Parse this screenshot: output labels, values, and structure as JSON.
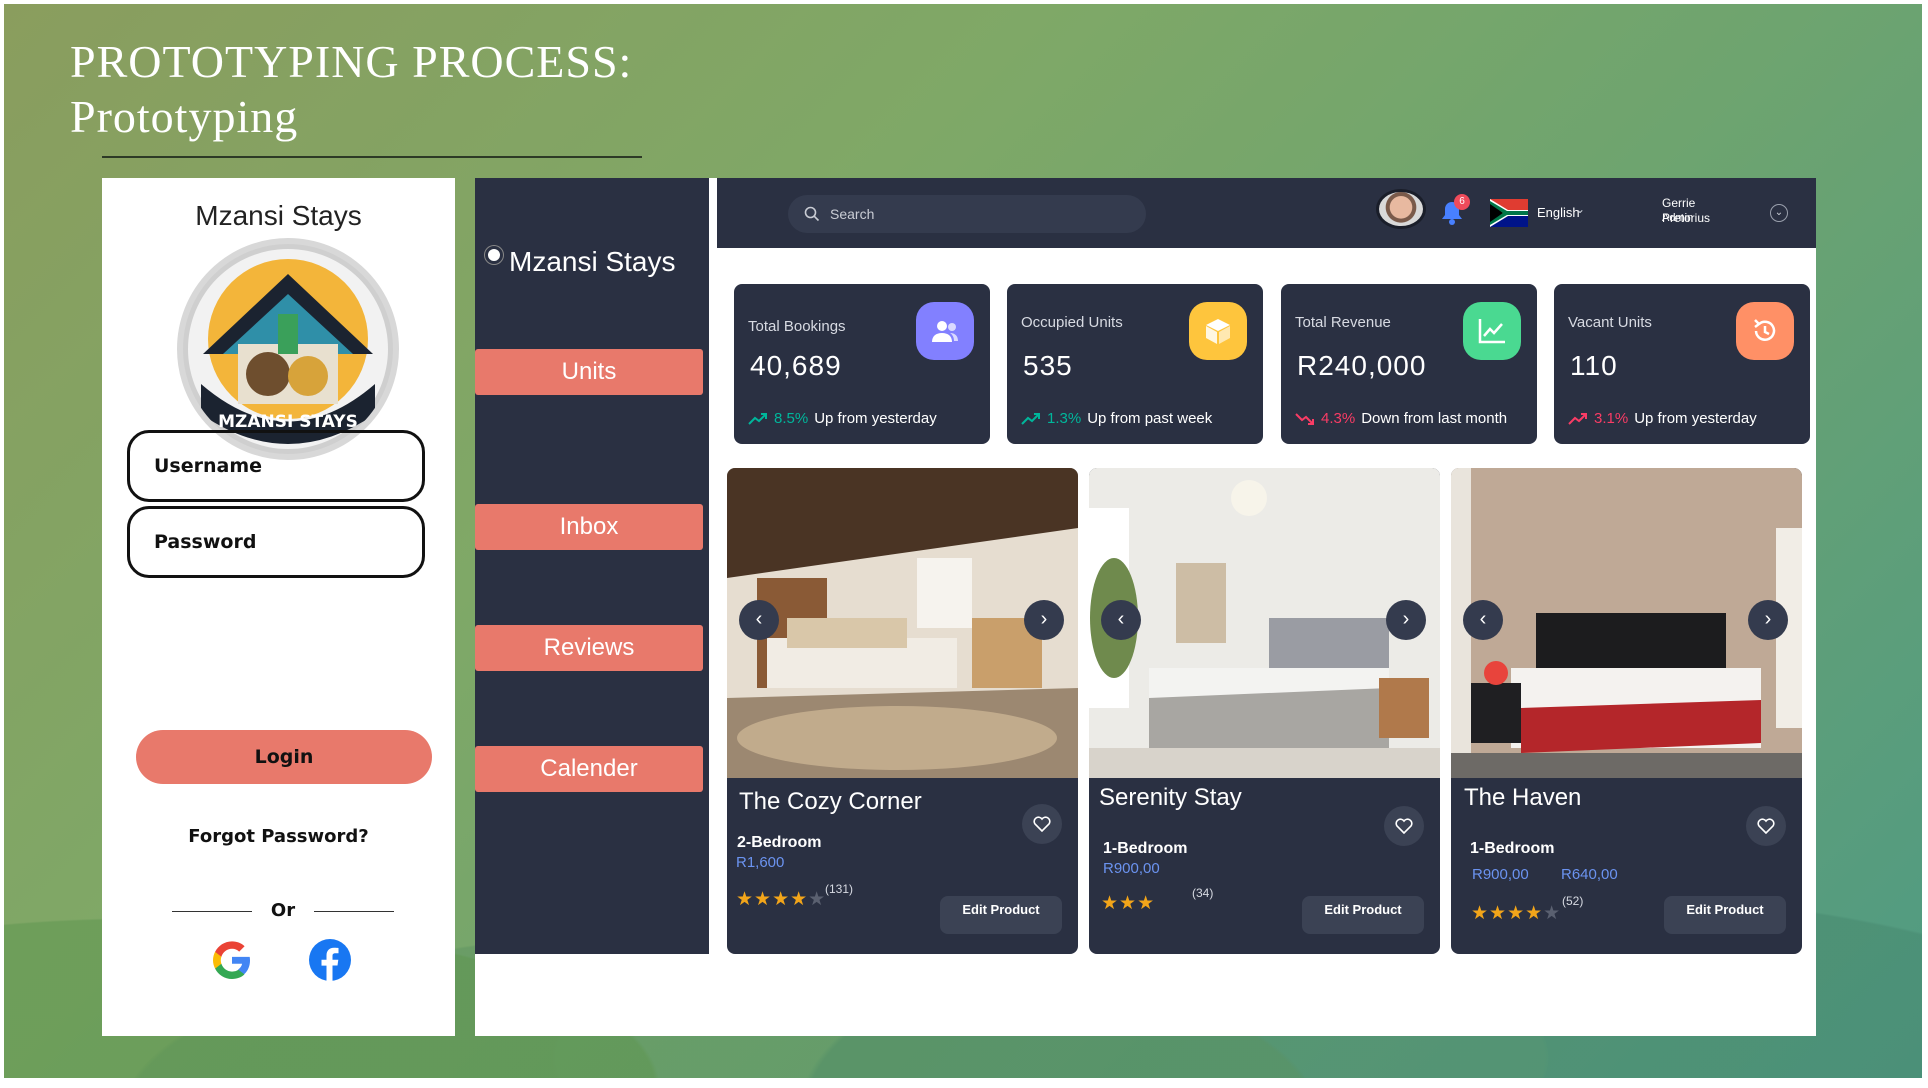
{
  "slide": {
    "title_line1": "PROTOTYPING PROCESS:",
    "title_line2": "Prototyping"
  },
  "login": {
    "brand": "Mzansi Stays",
    "logo_text": "MZANSI STAYS",
    "username_placeholder": "Username",
    "password_placeholder": "Password",
    "login_label": "Login",
    "forgot_label": "Forgot Password?",
    "or_label": "Or",
    "social": [
      "google-icon",
      "facebook-icon"
    ]
  },
  "sidebar": {
    "brand": "Mzansi Stays",
    "items": [
      {
        "label": "Units"
      },
      {
        "label": "Inbox"
      },
      {
        "label": "Reviews"
      },
      {
        "label": "Calender"
      }
    ]
  },
  "topbar": {
    "search_placeholder": "Search",
    "notification_count": "6",
    "language": "English",
    "user_name": "Gerrie Pretorius",
    "user_role": "Admin"
  },
  "stats": [
    {
      "label": "Total Bookings",
      "value": "40,689",
      "pct": "8.5%",
      "trend_text": "Up from yesterday",
      "direction": "up",
      "icon": "users-icon",
      "icon_bg": "#8280ff"
    },
    {
      "label": "Occupied Units",
      "value": "535",
      "pct": "1.3%",
      "trend_text": "Up from past week",
      "direction": "up",
      "icon": "box-icon",
      "icon_bg": "#fec53d"
    },
    {
      "label": "Total Revenue",
      "value": "R240,000",
      "pct": "4.3%",
      "trend_text": "Down from last month",
      "direction": "down",
      "icon": "chart-icon",
      "icon_bg": "#4ad991"
    },
    {
      "label": "Vacant Units",
      "value": "110",
      "pct": "3.1%",
      "trend_text": "Up from yesterday",
      "direction": "up",
      "icon": "history-icon",
      "icon_bg": "#ff9066"
    }
  ],
  "colors": {
    "accent": "#e8796b",
    "panel": "#2a3042",
    "up": "#00b69b",
    "down": "#f93c65",
    "price": "#6b93f0",
    "star": "#f2a51a"
  },
  "units": [
    {
      "title": "The Cozy Corner",
      "type": "2-Bedroom",
      "price": "R1,600",
      "old_price": "",
      "rating": 4,
      "reviews": "(131)",
      "edit_label": "Edit Product"
    },
    {
      "title": "Serenity Stay",
      "type": "1-Bedroom",
      "price": "R900,00",
      "old_price": "",
      "rating": 3,
      "reviews": "(34)",
      "edit_label": "Edit Product"
    },
    {
      "title": "The Haven",
      "type": "1-Bedroom",
      "price": "R640,00",
      "old_price": "R900,00",
      "rating": 4,
      "reviews": "(52)",
      "edit_label": "Edit Product"
    }
  ]
}
